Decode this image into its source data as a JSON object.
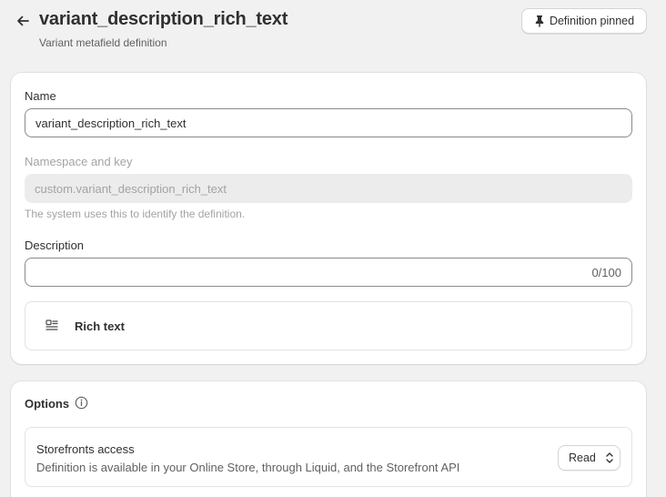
{
  "header": {
    "title": "variant_description_rich_text",
    "subtitle": "Variant metafield definition",
    "back_icon": "arrow-left-icon",
    "pin_button_label": "Definition pinned",
    "pin_icon": "pin-icon"
  },
  "form": {
    "name_label": "Name",
    "name_value": "variant_description_rich_text",
    "namespace_label": "Namespace and key",
    "namespace_value": "custom.variant_description_rich_text",
    "namespace_help": "The system uses this to identify the definition.",
    "description_label": "Description",
    "description_value": "",
    "description_counter": "0/100",
    "type_label": "Rich text",
    "type_icon": "rich-text-icon"
  },
  "options": {
    "title": "Options",
    "info_icon": "info-icon",
    "storefronts_title": "Storefronts access",
    "storefronts_description": "Definition is available in your Online Store, through Liquid, and the Storefront API",
    "access_value": "Read",
    "select_icon": "chevron-up-down-icon"
  }
}
